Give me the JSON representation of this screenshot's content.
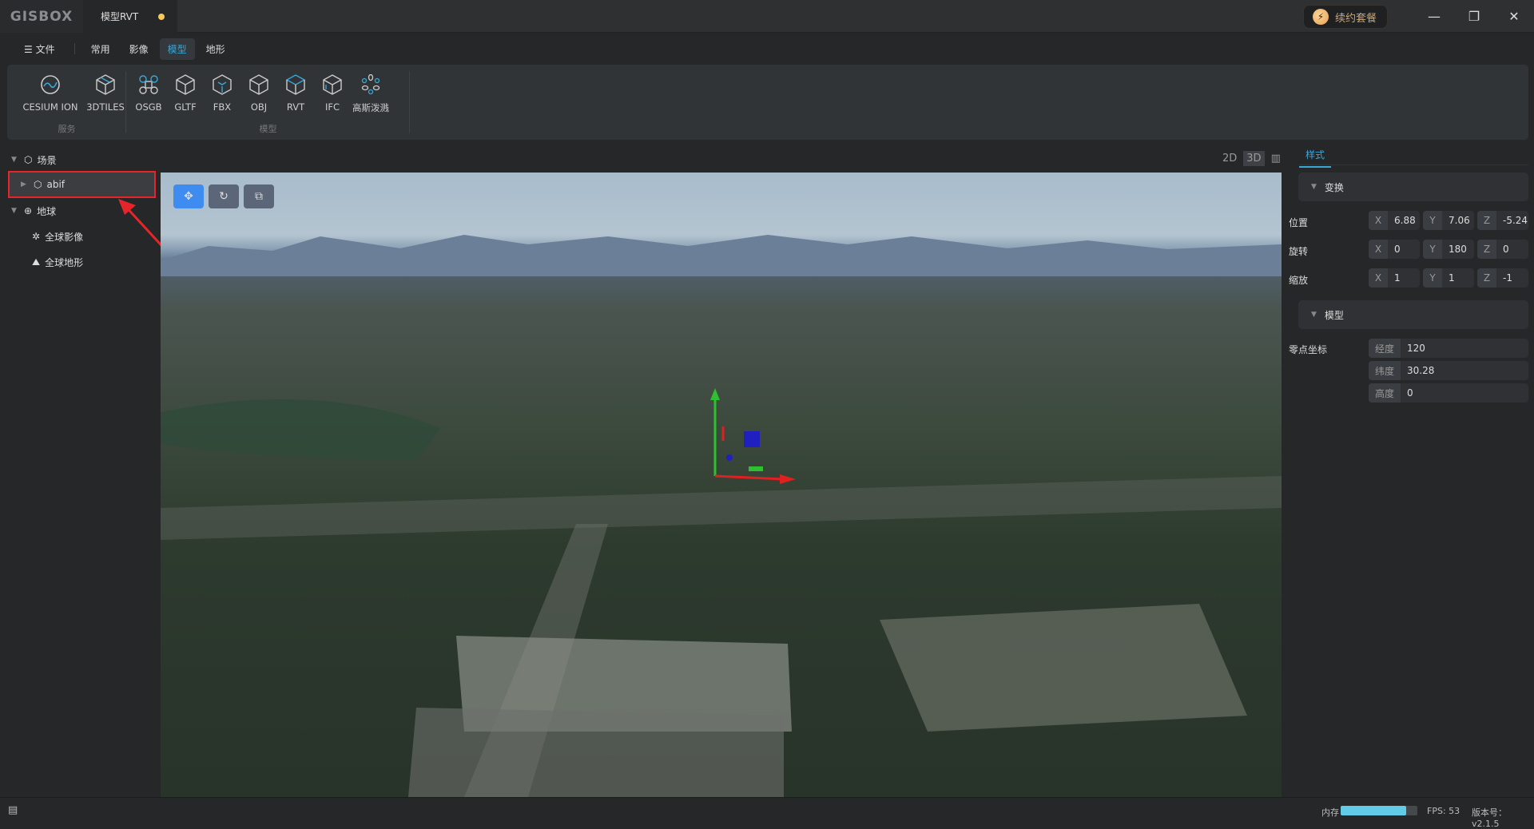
{
  "title_bar": {
    "logo": "GISBOX",
    "doc_tab": "模型RVT",
    "renew_label": "续约套餐",
    "minimize": "—",
    "restore": "❐",
    "close": "✕"
  },
  "menu": {
    "file": "文件",
    "tabs": [
      "常用",
      "影像",
      "模型",
      "地形"
    ],
    "active": "模型"
  },
  "ribbon": {
    "groups": [
      {
        "label": "服务",
        "buttons": [
          "CESIUM ION",
          "3DTILES"
        ]
      },
      {
        "label": "模型",
        "buttons": [
          "OSGB",
          "GLTF",
          "FBX",
          "OBJ",
          "RVT",
          "IFC",
          "高斯泼溅"
        ]
      }
    ]
  },
  "tree": {
    "scene": "场景",
    "model": "abif",
    "globe": "地球",
    "imagery": "全球影像",
    "terrain": "全球地形"
  },
  "view_modes": [
    "2D",
    "3D",
    "▥"
  ],
  "panel": {
    "tab": "样式",
    "transform_section": "变换",
    "model_section": "模型",
    "rows": [
      {
        "label": "位置",
        "x": "6.88",
        "y": "7.06",
        "z": "-5.24"
      },
      {
        "label": "旋转",
        "x": "0",
        "y": "180",
        "z": "0"
      },
      {
        "label": "缩放",
        "x": "1",
        "y": "1",
        "z": "-1"
      }
    ],
    "axis_labels": [
      "X",
      "Y",
      "Z"
    ],
    "origin_label": "零点坐标",
    "origin": [
      {
        "k": "经度",
        "v": "120"
      },
      {
        "k": "纬度",
        "v": "30.28"
      },
      {
        "k": "高度",
        "v": "0"
      }
    ]
  },
  "status": {
    "memory_label": "内存",
    "memory_fraction": 0.85,
    "fps": "FPS: 53",
    "version": "版本号：v2.1.5"
  },
  "colors": {
    "accent": "#3aa7d8",
    "highlight": "#e5252a",
    "active_tool": "#3f8cf0"
  }
}
